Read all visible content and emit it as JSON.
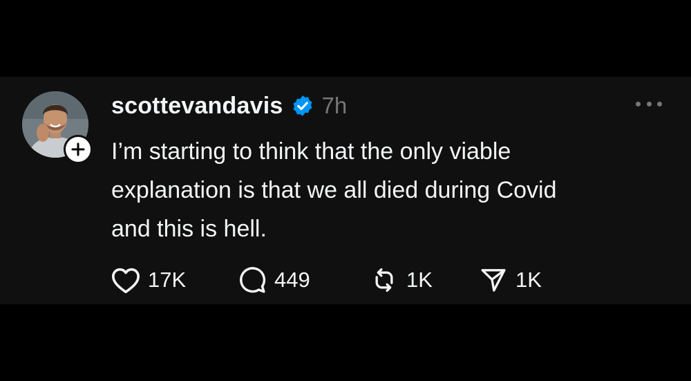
{
  "post": {
    "author": {
      "username": "scottevandavis",
      "verified": true,
      "avatar_icon": "profile-photo"
    },
    "timestamp": "7h",
    "text_lines": [
      "I’m starting to think that the only viable",
      "explanation is that we all died during Covid",
      "and this is hell."
    ],
    "actions": {
      "like": {
        "icon": "heart-icon",
        "count": "17K"
      },
      "reply": {
        "icon": "comment-icon",
        "count": "449"
      },
      "repost": {
        "icon": "repost-icon",
        "count": "1K"
      },
      "share": {
        "icon": "send-icon",
        "count": "1K"
      }
    }
  },
  "colors": {
    "page_background": "#000000",
    "post_background": "#101010",
    "primary_text": "#f3f5f7",
    "secondary_text": "#777777",
    "verified_badge": "#0095f6"
  }
}
